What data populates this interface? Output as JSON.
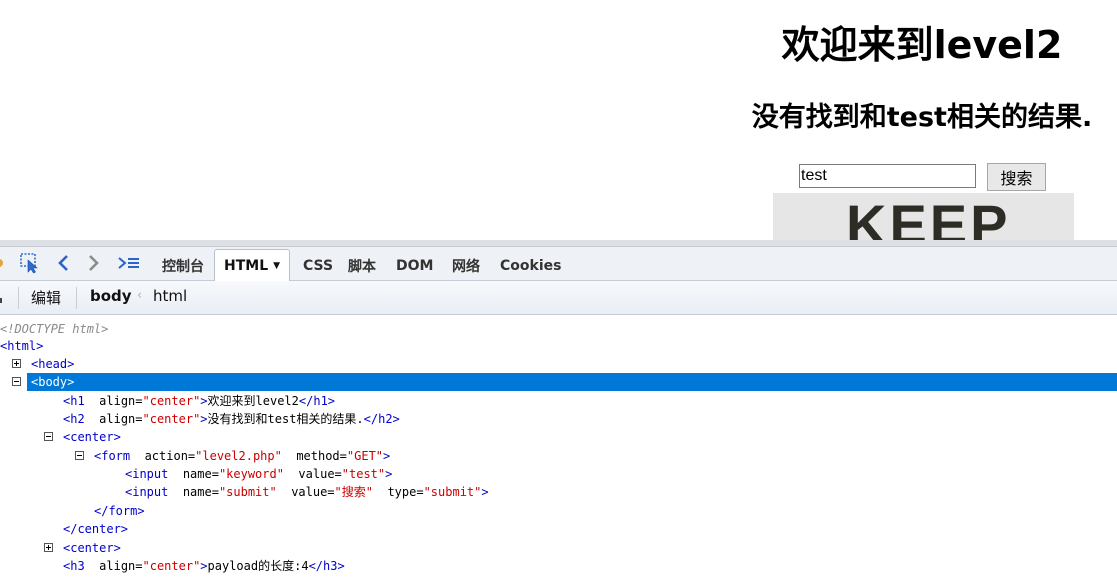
{
  "page": {
    "heading": "欢迎来到level2",
    "result": "没有找到和test相关的结果.",
    "search": {
      "value": "test",
      "button": "搜索"
    },
    "banner": "KEEP"
  },
  "devtools": {
    "tabs": [
      "控制台",
      "HTML",
      "CSS",
      "脚本",
      "DOM",
      "网络",
      "Cookies"
    ],
    "active_tab": "HTML",
    "edit_label": "编辑",
    "breadcrumb": [
      "body",
      "html"
    ],
    "colors": {
      "tag": "#0000cc",
      "value": "#cc0000",
      "selected": "#0078d7"
    },
    "source": {
      "doctype": "<!DOCTYPE html>",
      "html_open": "<html>",
      "head": "<head>",
      "body": "<body>",
      "h1": {
        "open": "<h1",
        "attr": "align=",
        "val": "\"center\"",
        "close": ">",
        "text": "欢迎来到level2",
        "end": "</h1>"
      },
      "h2": {
        "open": "<h2",
        "attr": "align=",
        "val": "\"center\"",
        "close": ">",
        "text": "没有找到和test相关的结果.",
        "end": "</h2>"
      },
      "center_open": "<center>",
      "form": {
        "open": "<form",
        "a1": "action=",
        "v1": "\"level2.php\"",
        "a2": "method=",
        "v2": "\"GET\"",
        "close": ">"
      },
      "input1": {
        "open": "<input",
        "a1": "name=",
        "v1": "\"keyword\"",
        "a2": "value=",
        "v2": "\"test\"",
        "close": ">"
      },
      "input2": {
        "open": "<input",
        "a1": "name=",
        "v1": "\"submit\"",
        "a2": "value=",
        "v2": "\"搜索\"",
        "a3": "type=",
        "v3": "\"submit\"",
        "close": ">"
      },
      "form_close": "</form>",
      "center_close": "</center>",
      "center2": "<center>",
      "h3": {
        "open": "<h3",
        "attr": "align=",
        "val": "\"center\"",
        "close": ">",
        "text": "payload的长度:4",
        "end": "</h3>"
      }
    }
  }
}
